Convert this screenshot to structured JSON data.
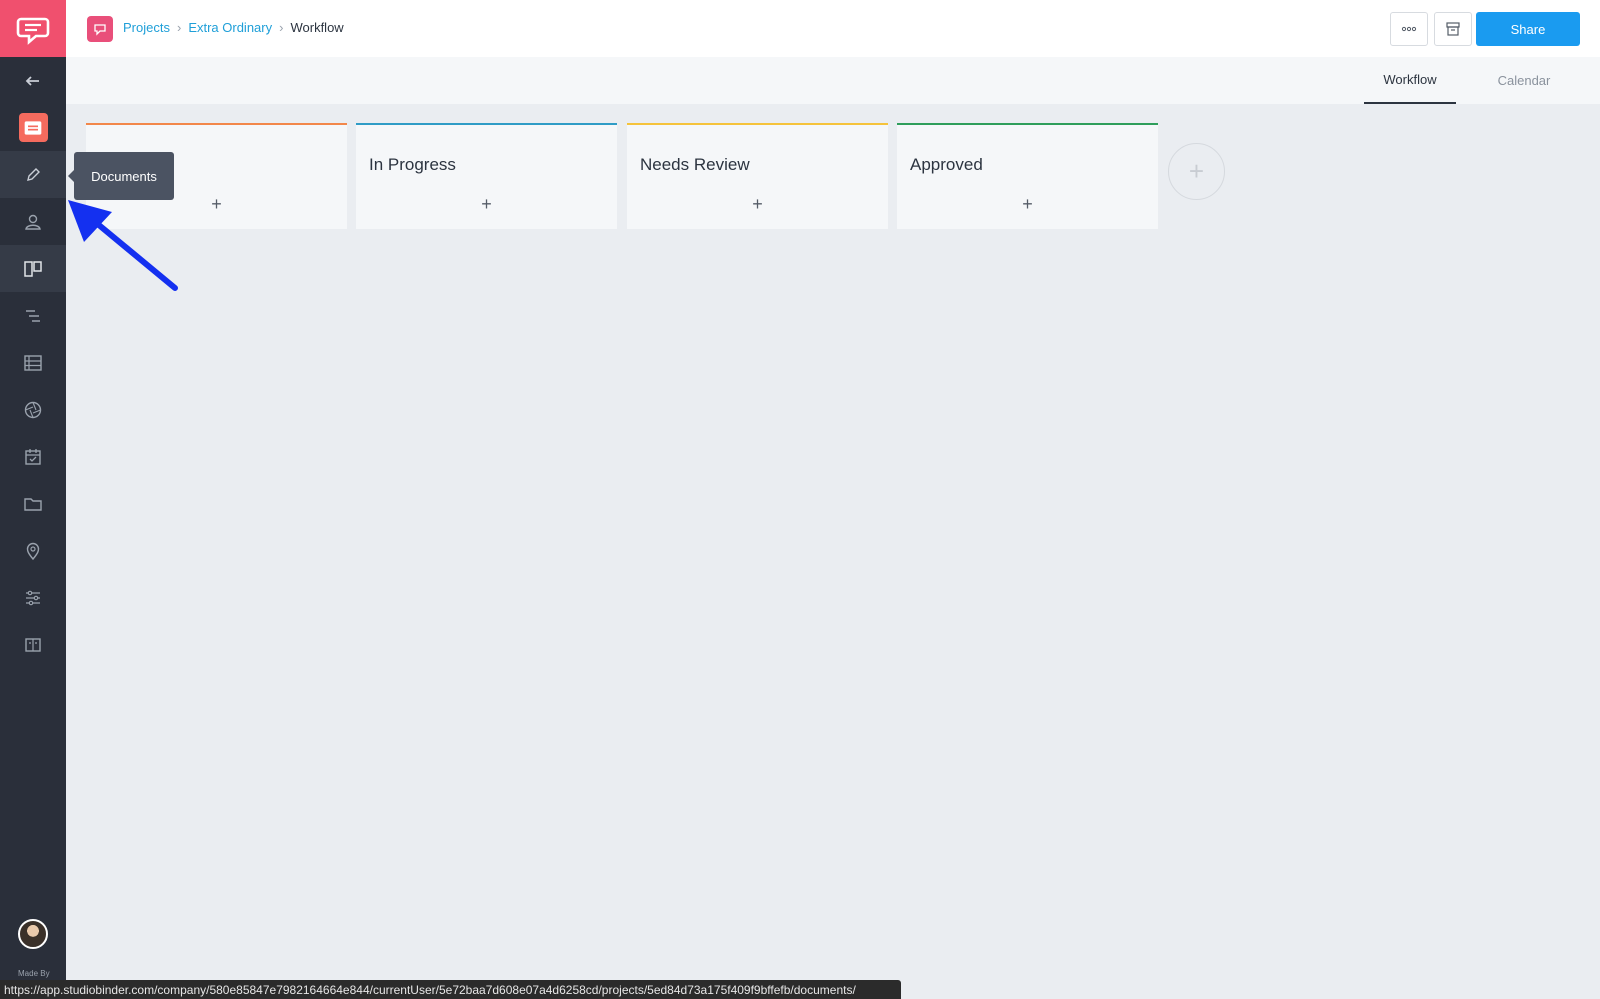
{
  "breadcrumb": {
    "items": [
      "Projects",
      "Extra Ordinary"
    ],
    "current": "Workflow"
  },
  "header": {
    "share_label": "Share",
    "more_icon": "ellipsis-icon",
    "archive_icon": "archive-icon"
  },
  "tabs": [
    {
      "label": "Workflow",
      "active": true
    },
    {
      "label": "Calendar",
      "active": false
    }
  ],
  "columns": [
    {
      "title": "",
      "color": "#f2874a",
      "add": "+"
    },
    {
      "title": "In Progress",
      "color": "#2f9cc6",
      "add": "+"
    },
    {
      "title": "Needs Review",
      "color": "#f5c33b",
      "add": "+"
    },
    {
      "title": "Approved",
      "color": "#2e9e5b",
      "add": "+"
    }
  ],
  "add_column": "+",
  "tooltip": "Documents",
  "sidebar": {
    "items": [
      "back-arrow-icon",
      "project-icon",
      "pencil-icon",
      "contacts-icon",
      "board-icon",
      "timeline-icon",
      "list-icon",
      "aperture-icon",
      "calendar-check-icon",
      "folder-icon",
      "location-pin-icon",
      "sliders-icon",
      "book-icon"
    ],
    "made_by": "Made By"
  },
  "status_url": "https://app.studiobinder.com/company/580e85847e7982164664e844/currentUser/5e72baa7d608e07a4d6258cd/projects/5ed84d73a175f409f9bffefb/documents/",
  "colors": {
    "sidebar": "#2a2f3a",
    "logo": "#f0506e",
    "share": "#1a9bf0",
    "link": "#1f9fd8",
    "annotation_arrow": "#1430f0"
  }
}
